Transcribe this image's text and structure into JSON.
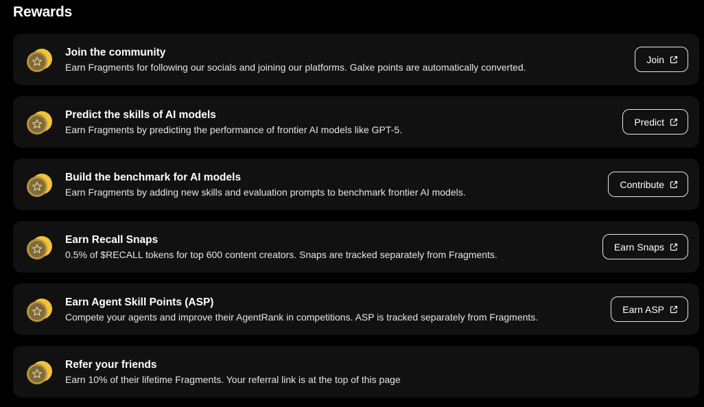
{
  "page": {
    "title": "Rewards"
  },
  "colors": {
    "background": "#000000",
    "card": "#111111",
    "coin_gold": "#d9a93a",
    "coin_face": "#8a7340"
  },
  "rewards": [
    {
      "icon": "coin-star-icon",
      "title": "Join the community",
      "description": "Earn Fragments for following our socials and joining our platforms. Galxe points are automatically converted.",
      "action_label": "Join",
      "action_icon": "external-link-icon"
    },
    {
      "icon": "coin-star-icon",
      "title": "Predict the skills of AI models",
      "description": "Earn Fragments by predicting the performance of frontier AI models like GPT-5.",
      "action_label": "Predict",
      "action_icon": "external-link-icon"
    },
    {
      "icon": "coin-star-icon",
      "title": "Build the benchmark for AI models",
      "description": "Earn Fragments by adding new skills and evaluation prompts to benchmark frontier AI models.",
      "action_label": "Contribute",
      "action_icon": "external-link-icon"
    },
    {
      "icon": "coin-star-icon",
      "title": "Earn Recall Snaps",
      "description": "0.5% of $RECALL tokens for top 600 content creators. Snaps are tracked separately from Fragments.",
      "action_label": "Earn Snaps",
      "action_icon": "external-link-icon"
    },
    {
      "icon": "coin-star-icon",
      "title": "Earn Agent Skill Points (ASP)",
      "description": "Compete your agents and improve their AgentRank in competitions. ASP is tracked separately from Fragments.",
      "action_label": "Earn ASP",
      "action_icon": "external-link-icon"
    },
    {
      "icon": "coin-star-icon",
      "title": "Refer your friends",
      "description": "Earn 10% of their lifetime Fragments. Your referral link is at the top of this page"
    }
  ]
}
